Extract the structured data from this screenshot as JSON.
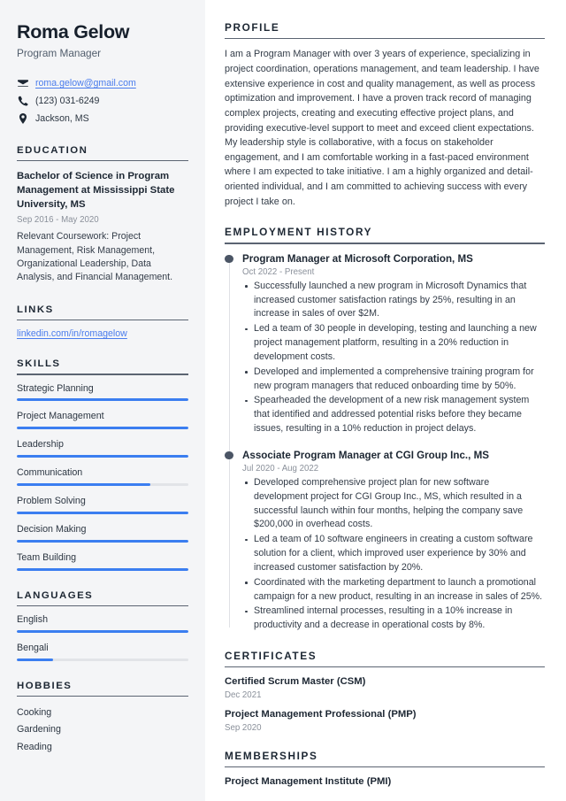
{
  "sidebar": {
    "name": "Roma Gelow",
    "job_title": "Program Manager",
    "contact": {
      "email": "roma.gelow@gmail.com",
      "phone": "(123) 031-6249",
      "location": "Jackson, MS"
    },
    "education": {
      "heading": "EDUCATION",
      "items": [
        {
          "degree": "Bachelor of Science in Program Management at Mississippi State University, MS",
          "dates": "Sep 2016 - May 2020",
          "description": "Relevant Coursework: Project Management, Risk Management, Organizational Leadership, Data Analysis, and Financial Management."
        }
      ]
    },
    "links": {
      "heading": "LINKS",
      "items": [
        {
          "label": "linkedin.com/in/romagelow"
        }
      ]
    },
    "skills": {
      "heading": "SKILLS",
      "items": [
        {
          "label": "Strategic Planning",
          "level": 100
        },
        {
          "label": "Project Management",
          "level": 100
        },
        {
          "label": "Leadership",
          "level": 100
        },
        {
          "label": "Communication",
          "level": 78
        },
        {
          "label": "Problem Solving",
          "level": 100
        },
        {
          "label": "Decision Making",
          "level": 100
        },
        {
          "label": "Team Building",
          "level": 100
        }
      ]
    },
    "languages": {
      "heading": "LANGUAGES",
      "items": [
        {
          "label": "English",
          "level": 100
        },
        {
          "label": "Bengali",
          "level": 21
        }
      ]
    },
    "hobbies": {
      "heading": "HOBBIES",
      "items": [
        {
          "label": "Cooking"
        },
        {
          "label": "Gardening"
        },
        {
          "label": "Reading"
        }
      ]
    }
  },
  "main": {
    "profile": {
      "heading": "PROFILE",
      "text": "I am a Program Manager with over 3 years of experience, specializing in project coordination, operations management, and team leadership. I have extensive experience in cost and quality management, as well as process optimization and improvement. I have a proven track record of managing complex projects, creating and executing effective project plans, and providing executive-level support to meet and exceed client expectations. My leadership style is collaborative, with a focus on stakeholder engagement, and I am comfortable working in a fast-paced environment where I am expected to take initiative. I am a highly organized and detail-oriented individual, and I am committed to achieving success with every project I take on."
    },
    "employment": {
      "heading": "EMPLOYMENT HISTORY",
      "jobs": [
        {
          "title": "Program Manager at Microsoft Corporation, MS",
          "dates": "Oct 2022 - Present",
          "bullets": [
            "Successfully launched a new program in Microsoft Dynamics that increased customer satisfaction ratings by 25%, resulting in an increase in sales of over $2M.",
            "Led a team of 30 people in developing, testing and launching a new project management platform, resulting in a 20% reduction in development costs.",
            "Developed and implemented a comprehensive training program for new program managers that reduced onboarding time by 50%.",
            "Spearheaded the development of a new risk management system that identified and addressed potential risks before they became issues, resulting in a 10% reduction in project delays."
          ]
        },
        {
          "title": "Associate Program Manager at CGI Group Inc., MS",
          "dates": "Jul 2020 - Aug 2022",
          "bullets": [
            "Developed comprehensive project plan for new software development project for CGI Group Inc., MS, which resulted in a successful launch within four months, helping the company save $200,000 in overhead costs.",
            "Led a team of 10 software engineers in creating a custom software solution for a client, which improved user experience by 30% and increased customer satisfaction by 20%.",
            "Coordinated with the marketing department to launch a promotional campaign for a new product, resulting in an increase in sales of 25%.",
            "Streamlined internal processes, resulting in a 10% increase in productivity and a decrease in operational costs by 8%."
          ]
        }
      ]
    },
    "certificates": {
      "heading": "CERTIFICATES",
      "items": [
        {
          "name": "Certified Scrum Master (CSM)",
          "date": "Dec 2021"
        },
        {
          "name": "Project Management Professional (PMP)",
          "date": "Sep 2020"
        }
      ]
    },
    "memberships": {
      "heading": "MEMBERSHIPS",
      "items": [
        {
          "name": "Project Management Institute (PMI)"
        }
      ]
    }
  },
  "colors": {
    "accent": "#3b7ef0",
    "link": "#4a7ced",
    "sidebar_bg": "#f4f5f7",
    "heading": "#1d2733",
    "muted": "#8a909a",
    "timeline_dot": "#4b5565"
  }
}
